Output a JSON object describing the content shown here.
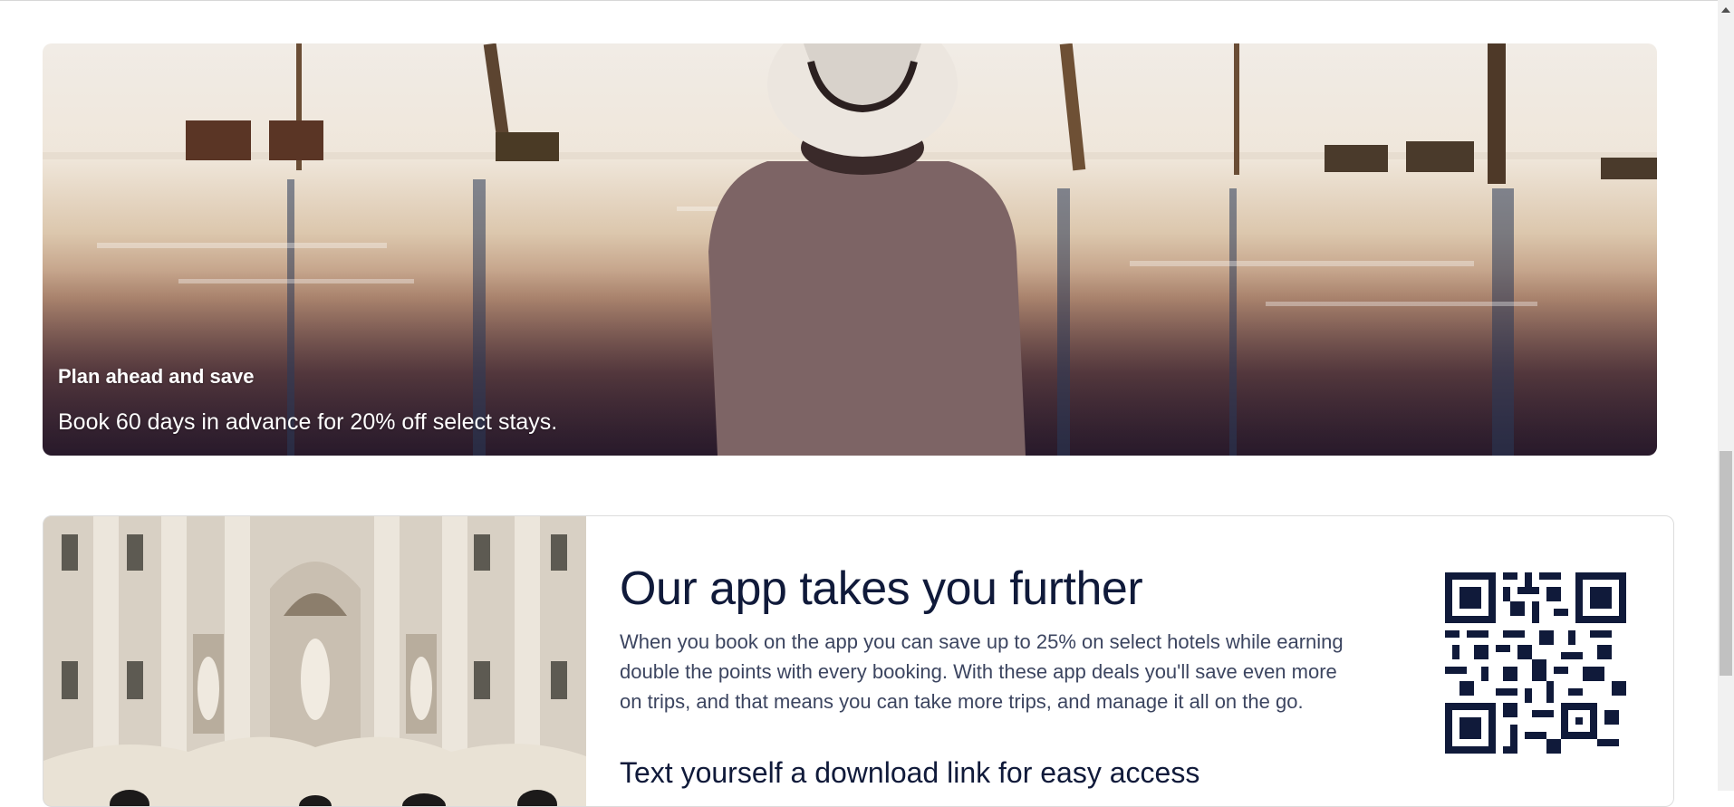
{
  "hero": {
    "eyebrow": "Plan ahead and save",
    "description": "Book 60 days in advance for 20% off select stays."
  },
  "app_promo": {
    "title": "Our app takes you further",
    "body": "When you book on the app you can save up to 25% on select hotels while earning double the points with every booking. With these app deals you'll save even more on trips, and that means you can take more trips, and manage it all on the go.",
    "subheading": "Text yourself a download link for easy access"
  },
  "colors": {
    "heading": "#101a3a",
    "body_text": "#3c4560",
    "card_border": "#dcdcdc"
  },
  "icons": [
    "chevron-up-icon",
    "qr-code"
  ]
}
